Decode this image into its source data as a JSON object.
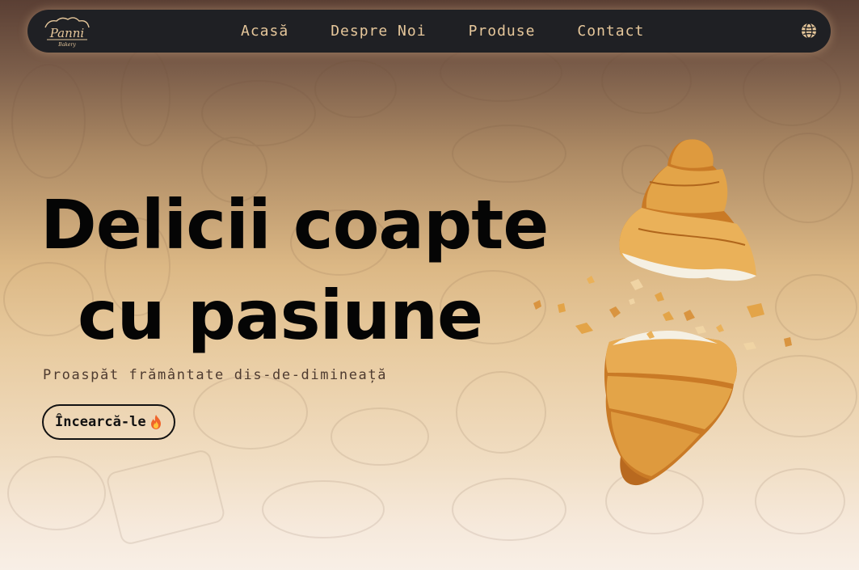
{
  "nav": {
    "logo_text": "Panni",
    "logo_subtext": "Bakery",
    "links": [
      {
        "label": "Acasă"
      },
      {
        "label": "Despre Noi"
      },
      {
        "label": "Produse"
      },
      {
        "label": "Contact"
      }
    ],
    "language_icon": "globe-icon"
  },
  "hero": {
    "title_line1": "Delicii coapte",
    "title_line2": "cu pasiune",
    "subtitle": "Proaspăt frământate dis-de-dimineață",
    "cta_label": "Încearcă-le",
    "cta_icon": "fire-icon"
  },
  "colors": {
    "nav_background": "#1f2024",
    "nav_text": "#e6c79b",
    "title_text": "#050505",
    "gradient_top": "#5a3f34",
    "gradient_mid": "#dcb885",
    "gradient_bottom": "#f8efe6"
  }
}
